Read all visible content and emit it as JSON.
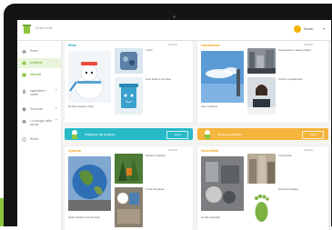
{
  "topbar": {
    "app_title": "Scuola verde",
    "user_name": "Mondo"
  },
  "sidebar": {
    "items": [
      {
        "label": "Home"
      },
      {
        "label": "Ambiente"
      },
      {
        "label": "Materiali"
      },
      {
        "label": "Ingredienti e ricette"
      },
      {
        "label": "Sicurezza"
      },
      {
        "label": "Lo sviluppo della scuola"
      },
      {
        "label": "Riciclo"
      }
    ]
  },
  "sections": {
    "rifiuti": {
      "title": "Rifiuti",
      "link": "Vedi tutti",
      "item1": "Da dove vengono i rifiuti",
      "item2": "Il vetro",
      "item3": "Dove finisce il mio rifiuto"
    },
    "inquinamento": {
      "title": "Inquinamento",
      "link": "Vedi tutti",
      "item1": "Aria e ambiente",
      "item2": "Inquinamento e salute pubblica",
      "item3": "Uomini e inquinamento"
    },
    "banner1": {
      "label": "Traduzioni del territorio",
      "button": "Scopri"
    },
    "banner2": {
      "label": "Concorso al riciclo",
      "button": "Scopri"
    },
    "ambiente": {
      "title": "Il pianeta",
      "link": "Vedi tutti",
      "item1": "Quali emissioni sono dannose",
      "item2": "Salviamo il pianeta",
      "item3": "Il ruolo dei pianeti"
    },
    "sostenibilita": {
      "title": "Sostenibilità",
      "link": "Vedi tutti",
      "item1": "Le città sostenibili",
      "item2": "Cose da fare",
      "item3": "Impronta ecologica"
    }
  },
  "colors": {
    "accent": "#8cc63f",
    "teal": "#28b9c7",
    "orange": "#f5b43c",
    "rifiuti_title": "#2ba8c9",
    "inquinamento_title": "#f0a31b"
  },
  "icons": {
    "logo": "recycle-logo-icon",
    "user": "user-avatar-icon"
  }
}
